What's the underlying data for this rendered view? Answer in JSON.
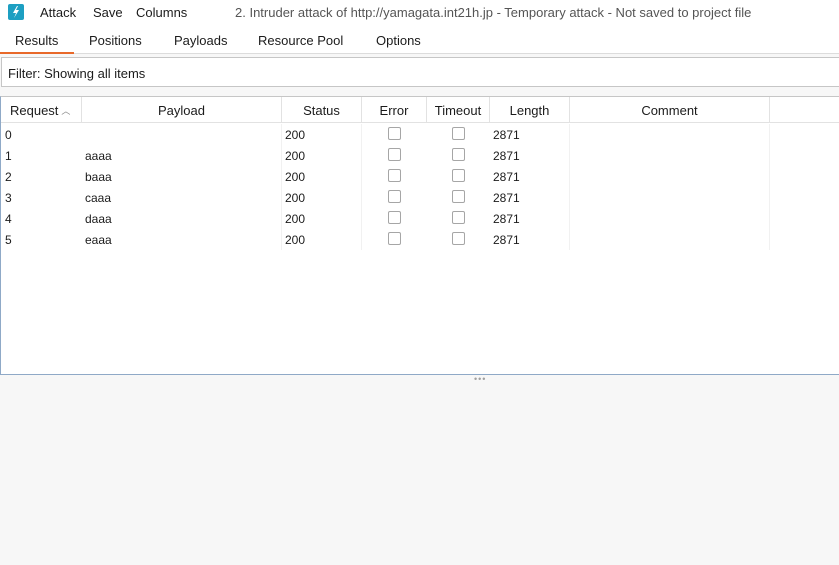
{
  "app": {
    "icon": "burp-lightning-icon",
    "accent": "#1d9fc2"
  },
  "menu": {
    "attack": "Attack",
    "save": "Save",
    "columns": "Columns"
  },
  "window_title": "2. Intruder attack of http://yamagata.int21h.jp - Temporary attack - Not saved to project file",
  "tabs": [
    {
      "label": "Results",
      "active": true
    },
    {
      "label": "Positions"
    },
    {
      "label": "Payloads"
    },
    {
      "label": "Resource Pool"
    },
    {
      "label": "Options"
    }
  ],
  "tab_accent": "#e8692a",
  "filter": {
    "text": "Filter: Showing all items"
  },
  "table": {
    "headers": {
      "request": "Request",
      "payload": "Payload",
      "status": "Status",
      "error": "Error",
      "timeout": "Timeout",
      "length": "Length",
      "comment": "Comment"
    },
    "sort_icon": "sort-ascending-icon",
    "rows": [
      {
        "request": "0",
        "payload": "",
        "status": "200",
        "error": false,
        "timeout": false,
        "length": "2871",
        "comment": ""
      },
      {
        "request": "1",
        "payload": "aaaa",
        "status": "200",
        "error": false,
        "timeout": false,
        "length": "2871",
        "comment": ""
      },
      {
        "request": "2",
        "payload": "baaa",
        "status": "200",
        "error": false,
        "timeout": false,
        "length": "2871",
        "comment": ""
      },
      {
        "request": "3",
        "payload": "caaa",
        "status": "200",
        "error": false,
        "timeout": false,
        "length": "2871",
        "comment": ""
      },
      {
        "request": "4",
        "payload": "daaa",
        "status": "200",
        "error": false,
        "timeout": false,
        "length": "2871",
        "comment": ""
      },
      {
        "request": "5",
        "payload": "eaaa",
        "status": "200",
        "error": false,
        "timeout": false,
        "length": "2871",
        "comment": ""
      }
    ]
  }
}
